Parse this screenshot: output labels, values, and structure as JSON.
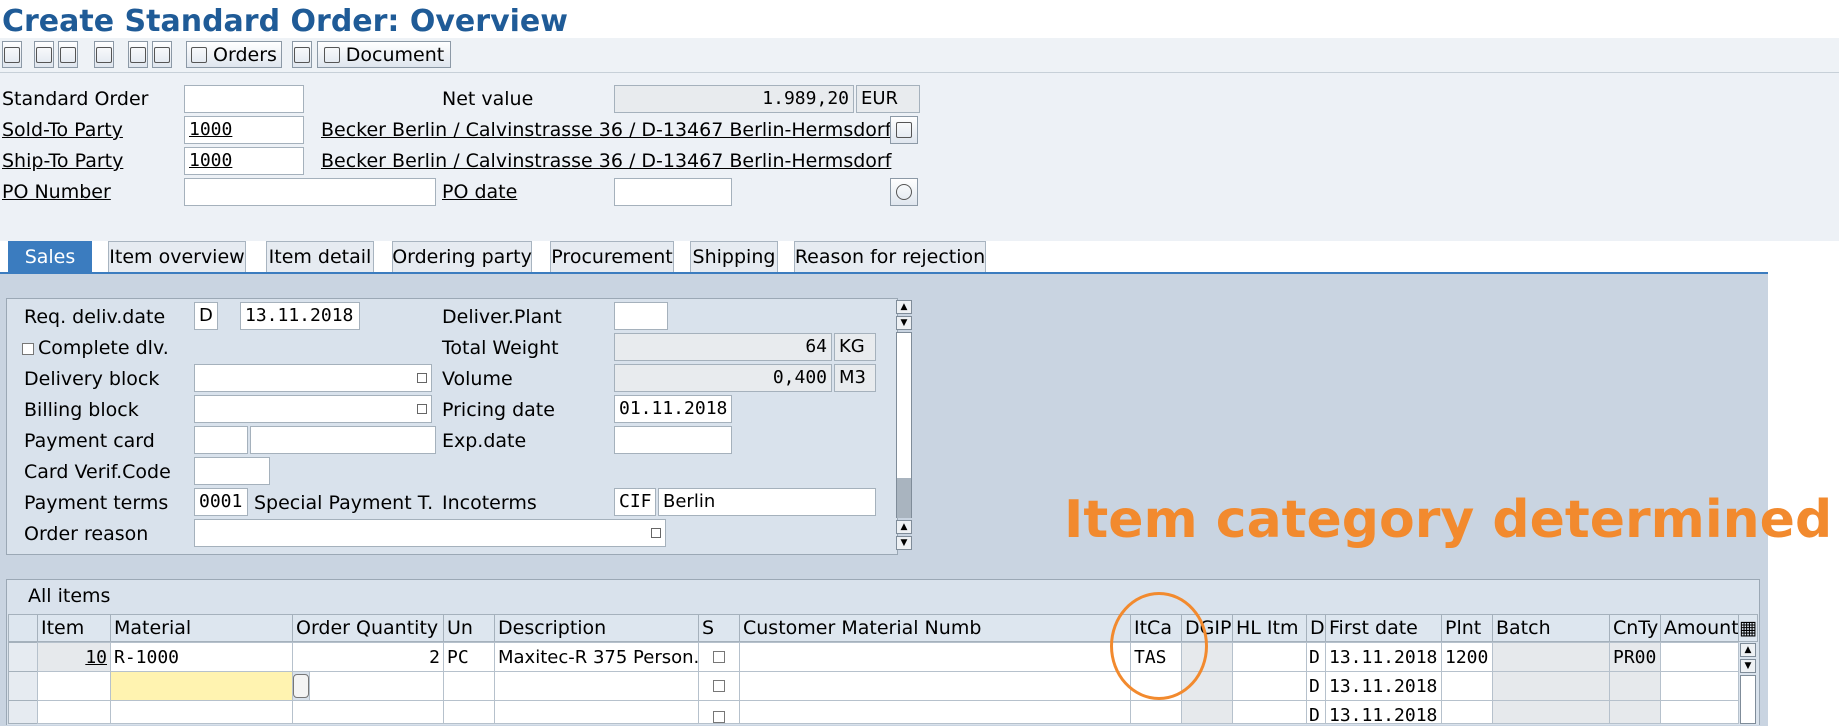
{
  "title": "Create Standard Order: Overview",
  "toolbar": {
    "orders_label": "Orders",
    "document_label": "Document"
  },
  "header": {
    "standard_order_label": "Standard Order",
    "standard_order_value": "",
    "net_value_label": "Net value",
    "net_value": "1.989,20",
    "currency": "EUR",
    "sold_to_label": "Sold-To Party",
    "sold_to_value": "1000",
    "sold_to_address": "Becker Berlin / Calvinstrasse 36 / D-13467 Berlin-Hermsdorf",
    "ship_to_label": "Ship-To Party",
    "ship_to_value": "1000",
    "ship_to_address": "Becker Berlin / Calvinstrasse 36 / D-13467 Berlin-Hermsdorf",
    "po_number_label": "PO Number",
    "po_number_value": "",
    "po_date_label": "PO date",
    "po_date_value": ""
  },
  "tabs": [
    "Sales",
    "Item overview",
    "Item detail",
    "Ordering party",
    "Procurement",
    "Shipping",
    "Reason for rejection"
  ],
  "sales": {
    "req_deliv_label": "Req. deliv.date",
    "req_deliv_type": "D",
    "req_deliv_date": "13.11.2018",
    "complete_dlv_label": "Complete dlv.",
    "delivery_block_label": "Delivery block",
    "billing_block_label": "Billing block",
    "payment_card_label": "Payment card",
    "card_verif_label": "Card Verif.Code",
    "payment_terms_label": "Payment terms",
    "payment_terms_code": "0001",
    "payment_terms_text": "Special Payment T...",
    "order_reason_label": "Order reason",
    "deliver_plant_label": "Deliver.Plant",
    "total_weight_label": "Total Weight",
    "total_weight": "64",
    "weight_unit": "KG",
    "volume_label": "Volume",
    "volume": "0,400",
    "volume_unit": "M3",
    "pricing_date_label": "Pricing date",
    "pricing_date": "01.11.2018",
    "exp_date_label": "Exp.date",
    "incoterms_label": "Incoterms",
    "incoterms_code": "CIF",
    "incoterms_place": "Berlin"
  },
  "annotation": "Item category determined",
  "items": {
    "title": "All items",
    "columns": [
      "Item",
      "Material",
      "Order Quantity",
      "Un",
      "Description",
      "S",
      "Customer Material Numb",
      "ItCa",
      "DGIP",
      "HL Itm",
      "D",
      "First date",
      "Plnt",
      "Batch",
      "CnTy",
      "Amount"
    ],
    "rows": [
      {
        "item": "10",
        "material": "R-1000",
        "qty": "2",
        "un": "PC",
        "desc": "Maxitec-R 375 Person...",
        "itca": "TAS",
        "d": "D",
        "first_date": "13.11.2018",
        "plnt": "1200",
        "cnty": "PR00"
      },
      {
        "item": "",
        "material": "",
        "qty": "",
        "un": "",
        "desc": "",
        "itca": "",
        "d": "D",
        "first_date": "13.11.2018",
        "plnt": "",
        "cnty": ""
      },
      {
        "item": "",
        "material": "",
        "qty": "",
        "un": "",
        "desc": "",
        "itca": "",
        "d": "D",
        "first_date": "13.11.2018",
        "plnt": "",
        "cnty": ""
      }
    ]
  }
}
